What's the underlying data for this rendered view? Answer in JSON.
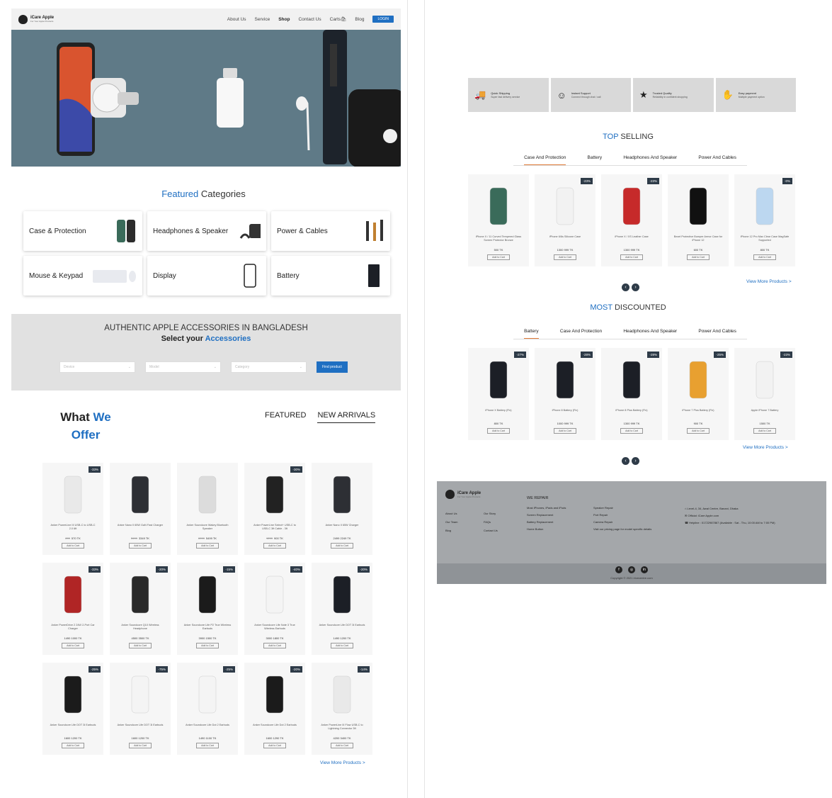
{
  "nav": {
    "logo_title": "iCare Apple",
    "logo_sub": "For Your Apple Products",
    "links": [
      "About Us",
      "Service",
      "Shop",
      "Contact Us",
      "Carts",
      "Blog"
    ],
    "login": "LOGIN"
  },
  "featured": {
    "title_a": "Featured",
    "title_b": "Categories"
  },
  "categories": [
    "Case & Protection",
    "Headphones & Speaker",
    "Power & Cables",
    "Mouse & Keypad",
    "Display",
    "Battery"
  ],
  "search": {
    "headline": "AUTHENTIC APPLE ACCESSORIES IN BANGLADESH",
    "sub_a": "Select your",
    "sub_b": "Accessories",
    "device_placeholder": "Device",
    "model_placeholder": "Model",
    "category_placeholder": "Category",
    "button": "Find product"
  },
  "offer": {
    "title_a": "What",
    "title_b": "We",
    "title_c": "Offer",
    "tab_featured": "FEATURED",
    "tab_new": "NEW ARRIVALS"
  },
  "offer_products": [
    {
      "name": "Anker PowerLine III USB-C to USB-C 2.0 6ft",
      "old": "899",
      "price": "570 TK",
      "badge": "-33%"
    },
    {
      "name": "Anker Nano II 65W GaN Fast Charger",
      "old": "3499",
      "price": "3349 TK",
      "badge": ""
    },
    {
      "name": "Anker Soundcore Wakey Bluetooth Speaker",
      "old": "6999",
      "price": "5499 TK",
      "badge": ""
    },
    {
      "name": "Anker PowerLine Select+ USB-C to USB-C 3ft Cable - 3ft",
      "old": "1299",
      "price": "900 TK",
      "badge": "-30%"
    },
    {
      "name": "Anker Nano II 65W Charger",
      "old": "",
      "price": "2499 2249 TK",
      "badge": ""
    },
    {
      "name": "Anker PowerDrive 2 24W 2-Port Car Charger",
      "old": "",
      "price": "1490 1000 TK",
      "badge": "-33%"
    },
    {
      "name": "Anker Soundcore Q10 Wireless Headphone",
      "old": "",
      "price": "4500 3500 TK",
      "badge": "-20%"
    },
    {
      "name": "Anker Soundcore Life P2 True Wireless Earbuds",
      "old": "",
      "price": "3900 1500 TK",
      "badge": "-15%"
    },
    {
      "name": "Anker Soundcore Life Note 3 True Wireless Earbuds",
      "old": "",
      "price": "3000 1800 TK",
      "badge": "-40%"
    },
    {
      "name": "Anker Soundcore Life DOT 3i Earbuds",
      "old": "",
      "price": "1490 1200 TK",
      "badge": "-20%"
    },
    {
      "name": "Anker Soundcore Life DOT 3i Earbuds",
      "old": "",
      "price": "1600 1200 TK",
      "badge": "-25%"
    },
    {
      "name": "Anker Soundcore Life DOT 3i Earbuds",
      "old": "",
      "price": "1600 1200 TK",
      "badge": "-75%"
    },
    {
      "name": "Anker Soundcore Life Dot 2 Earbuds",
      "old": "",
      "price": "1490 1100 TK",
      "badge": "-25%"
    },
    {
      "name": "Anker Soundcore Life Dot 2 Earbuds",
      "old": "",
      "price": "1600 1290 TK",
      "badge": "-20%"
    },
    {
      "name": "Anker PowerLine III Flow USB-C to Lightning Connector 3ft",
      "old": "",
      "price": "4200 3400 TK",
      "badge": "-14%"
    }
  ],
  "offer_viewmore": "View More Products >",
  "features": [
    {
      "icon": "truck-icon",
      "title": "Quick Shipping",
      "sub": "Super fast delivery service"
    },
    {
      "icon": "support-icon",
      "title": "Instant Support",
      "sub": "Connect through chat / call"
    },
    {
      "icon": "quality-icon",
      "title": "Trusted Quality",
      "sub": "Reliability in confident shopping"
    },
    {
      "icon": "payment-icon",
      "title": "Easy payment",
      "sub": "Multiple payment option"
    }
  ],
  "top_selling": {
    "title_a": "TOP",
    "title_b": "SELLING",
    "tabs": [
      "Case And Protection",
      "Battery",
      "Headphones And Speaker",
      "Power And Cables"
    ],
    "products": [
      {
        "name": "iPhone X / 11 Curved Tempered Glass Screen Protector Bronze",
        "price": "500 TK",
        "badge": ""
      },
      {
        "name": "iPhone 6/6s Silicone Case",
        "price": "1300 999 TK",
        "badge": "-23%"
      },
      {
        "name": "iPhone X / XS Leather Case",
        "price": "1300 999 TK",
        "badge": "-23%"
      },
      {
        "name": "Bezel Protective Bumper Armor Case for iPhone 12",
        "price": "600 TK",
        "badge": ""
      },
      {
        "name": "iPhone 12 Pro Max Clear Case MagSafe Supported",
        "price": "800 TK",
        "badge": "-0%"
      }
    ],
    "viewmore": "View More Products >"
  },
  "most_discounted": {
    "title_a": "MOST",
    "title_b": "DISCOUNTED",
    "tabs": [
      "Battery",
      "Case And Protection",
      "Headphones And Speaker",
      "Power And Cables"
    ],
    "products": [
      {
        "name": "iPhone X Battery (Fix)",
        "price": "800 TK",
        "badge": "-27%"
      },
      {
        "name": "iPhone 8 Battery (Fix)",
        "price": "1000 999 TK",
        "badge": "-28%"
      },
      {
        "name": "iPhone 8 Plus Battery (Fix)",
        "price": "1300 999 TK",
        "badge": "-28%"
      },
      {
        "name": "iPhone 7 Plus Battery (Fix)",
        "price": "900 TK",
        "badge": "-25%"
      },
      {
        "name": "Apple iPhone 7 Battery",
        "price": "1500 TK",
        "badge": "-23%"
      }
    ],
    "viewmore": "View More Products >"
  },
  "footer": {
    "logo_title": "iCare Apple",
    "logo_sub": "For Your Apple Products",
    "col1": [
      "About Us",
      "Our Team",
      "Blog"
    ],
    "col2": [
      "Our Story",
      "FAQs",
      "Contact Us"
    ],
    "repair_head": "WE REPAIR",
    "col3": [
      "Most iPhones, iPads and iPods",
      "Screen Replacement",
      "Battery Replacement",
      "Home Button"
    ],
    "col4": [
      "Speaker Repair",
      "Port Repair",
      "Camera Repair",
      "Visit our pricing page for model specific details"
    ],
    "address": "Level-4, 34, Awal Centre, Banani, Dhaka",
    "email": "Official: iCare Apple.com",
    "phone": "Helpline : 01722987867 (Available : Sat - Thu, 10:00 AM to 7:00 PM)",
    "copyright": "Copyright © 2021 iricecentre.com"
  }
}
